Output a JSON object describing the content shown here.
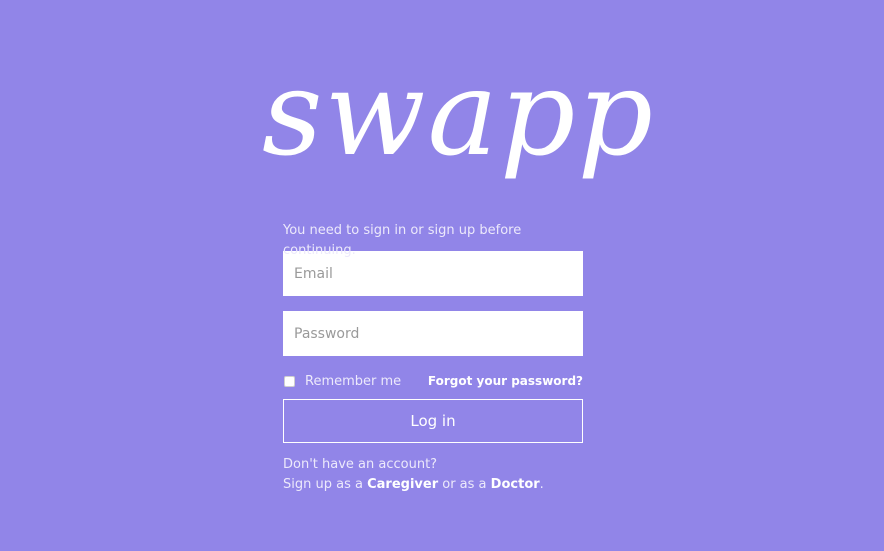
{
  "logo": {
    "text": "swapp"
  },
  "notice": "You need to sign in or sign up before continuing.",
  "form": {
    "email_placeholder": "Email",
    "password_placeholder": "Password",
    "remember_label": "Remember me",
    "remember_checked": false,
    "forgot_label": "Forgot your password?",
    "login_label": "Log in"
  },
  "signup": {
    "question": "Don't have an account?",
    "prefix": "Sign up as a",
    "caregiver_label": "Caregiver",
    "middle": "or as a",
    "doctor_label": "Doctor",
    "suffix": "."
  },
  "colors": {
    "background": "#9185e8",
    "text": "#ffffff"
  }
}
